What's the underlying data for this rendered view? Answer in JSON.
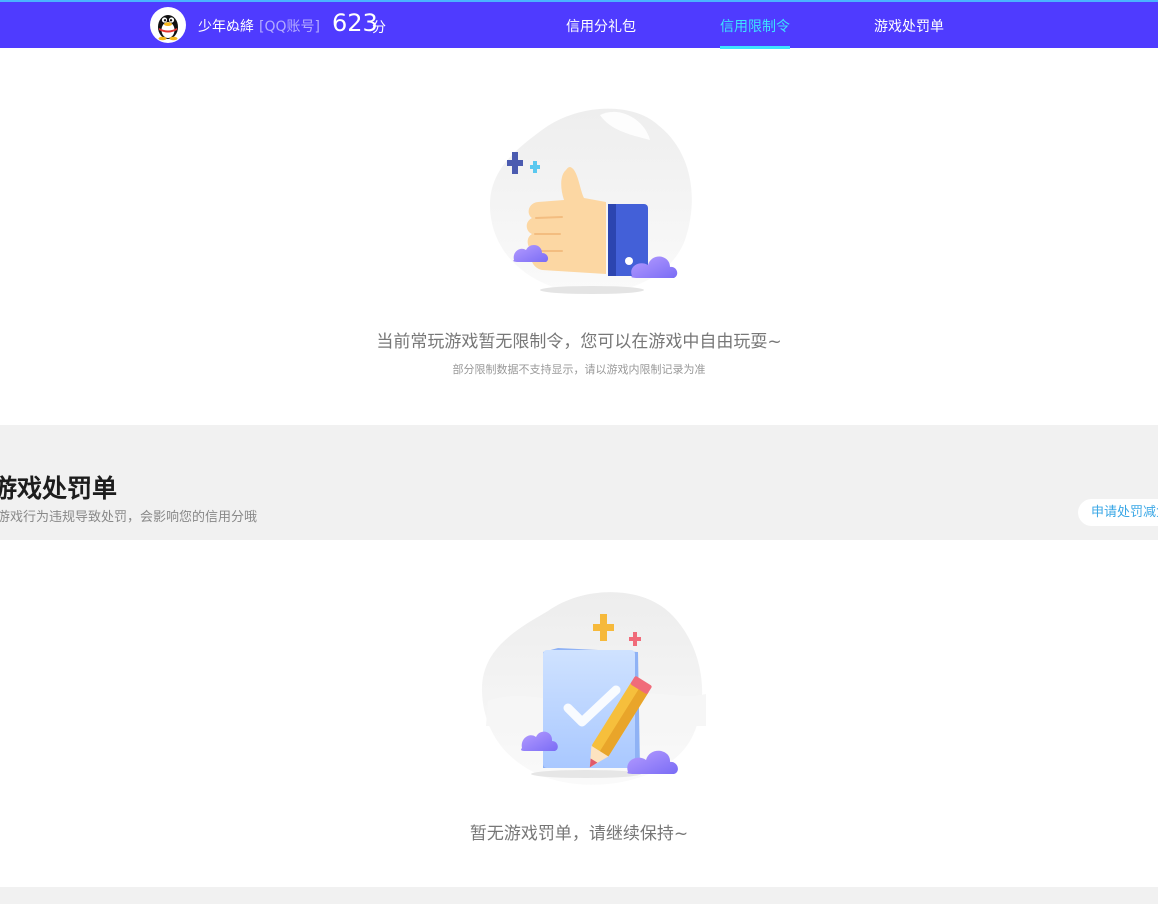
{
  "header": {
    "user_name": "少年ぬ絳",
    "account_tag": "[QQ账号]",
    "score": "623",
    "score_unit": "分",
    "nav": [
      {
        "label": "信用分礼包",
        "active": false
      },
      {
        "label": "信用限制令",
        "active": true
      },
      {
        "label": "游戏处罚单",
        "active": false
      }
    ],
    "accent_color": "#4f3bff",
    "active_color": "#3de3ff"
  },
  "restriction": {
    "illustration_icon": "thumbs-up-icon",
    "message": "当前常玩游戏暂无限制令，您可以在游戏中自由玩耍~",
    "note": "部分限制数据不支持显示，请以游戏内限制记录为准"
  },
  "penalty": {
    "title": "游戏处罚单",
    "subtitle": "游戏行为违规导致处罚，会影响您的信用分哦",
    "apply_button": "申请处罚减免",
    "illustration_icon": "checklist-pencil-icon",
    "empty_message": "暂无游戏罚单，请继续保持~"
  }
}
